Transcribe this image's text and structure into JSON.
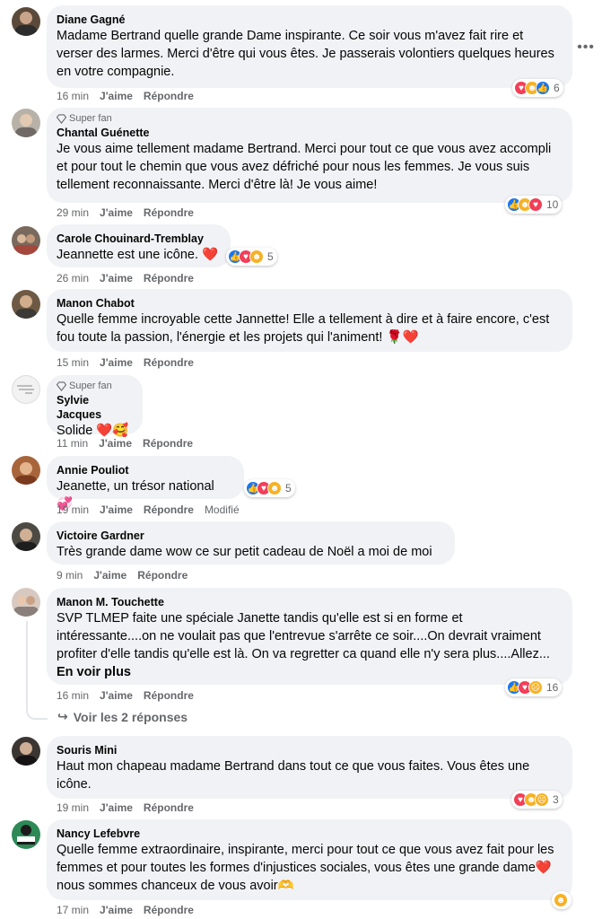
{
  "labels": {
    "like": "J'aime",
    "reply": "Répondre",
    "modified": "Modifié",
    "superfan": "Super fan",
    "more": "En voir plus"
  },
  "comments": [
    {
      "name": "Diane Gagné",
      "time": "16 min",
      "text": "Madame Bertrand quelle grande Dame inspirante. Ce soir vous m'avez fait rire et verser des larmes. Merci d'être qui vous êtes. Je passerais volontiers quelques heures en votre compagnie.",
      "reactions": [
        "love",
        "care",
        "like"
      ],
      "count": "6"
    },
    {
      "name": "Chantal Guénette",
      "time": "29 min",
      "superfan": true,
      "text": "Je vous aime tellement madame Bertrand. Merci pour tout ce que vous avez accompli et pour tout le chemin que vous avez défriché pour nous les femmes. Je vous suis tellement reconnaissante. Merci d'être là! Je vous aime!",
      "reactions": [
        "like",
        "care",
        "love"
      ],
      "count": "10"
    },
    {
      "name": "Carole Chouinard-Tremblay",
      "time": "26 min",
      "text": "Jeannette est une icône. ❤️",
      "reactions": [
        "like",
        "love",
        "care"
      ],
      "count": "5"
    },
    {
      "name": "Manon Chabot",
      "time": "15 min",
      "text": "Quelle femme incroyable cette Jannette! Elle a tellement à dire et à faire encore, c'est fou toute la passion, l'énergie et les projets qui l'animent! 🌹❤️"
    },
    {
      "name": "Sylvie Jacques",
      "time": "11 min",
      "superfan": true,
      "text": "Solide ❤️🥰"
    },
    {
      "name": "Annie Pouliot",
      "time": "19 min",
      "text": "Jeanette, un trésor national 💞",
      "reactions": [
        "like",
        "love",
        "care"
      ],
      "count": "5",
      "modified": true
    },
    {
      "name": "Victoire Gardner",
      "time": "9 min",
      "text": "Très grande dame wow ce sur petit cadeau de Noël a moi de moi"
    },
    {
      "name": "Manon M. Touchette",
      "time": "16 min",
      "text": "SVP TLMEP faite une spéciale Janette tandis qu'elle est si en forme et intéressante....on ne voulait pas que l'entrevue s'arrête ce soir....On devrait vraiment profiter d'elle tandis qu'elle est là. On va regretter ca quand elle n'y sera plus....Allez...",
      "reactions": [
        "like",
        "love",
        "sad"
      ],
      "count": "16",
      "replies": "Voir les 2 réponses"
    },
    {
      "name": "Souris Mini",
      "time": "19 min",
      "text": "Haut mon chapeau madame Bertrand dans tout ce que vous faites. Vous êtes une icône.",
      "reactions": [
        "love",
        "care",
        "sad"
      ],
      "count": "3"
    },
    {
      "name": "Nancy Lefebvre",
      "time": "17 min",
      "text": "Quelle femme extraordinaire, inspirante, merci pour tout ce que vous avez fait pour les femmes et pour toutes les formes d'injustices sociales, vous êtes une grande dame❤️ nous sommes chanceux de vous avoir🫶",
      "reactions": [
        "care"
      ]
    }
  ]
}
